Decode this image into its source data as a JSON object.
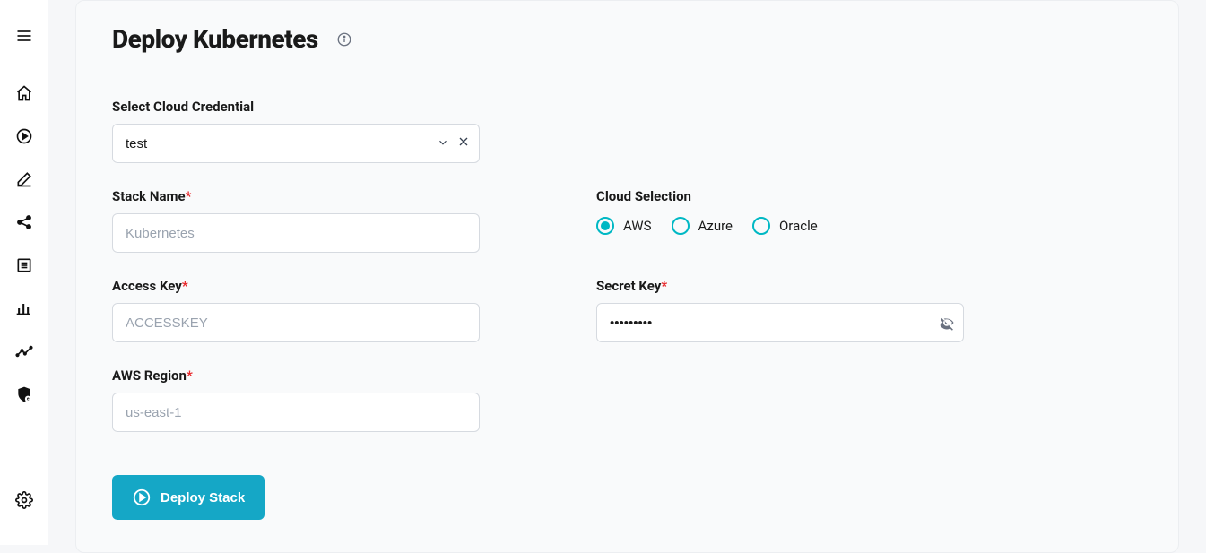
{
  "page": {
    "title": "Deploy Kubernetes"
  },
  "form": {
    "credential": {
      "label": "Select Cloud Credential",
      "value": "test"
    },
    "stackName": {
      "label": "Stack Name",
      "placeholder": "Kubernetes",
      "value": ""
    },
    "cloudSelection": {
      "label": "Cloud Selection",
      "options": [
        {
          "key": "aws",
          "label": "AWS",
          "checked": true
        },
        {
          "key": "azure",
          "label": "Azure",
          "checked": false
        },
        {
          "key": "oracle",
          "label": "Oracle",
          "checked": false
        }
      ]
    },
    "accessKey": {
      "label": "Access Key",
      "placeholder": "ACCESSKEY",
      "value": ""
    },
    "secretKey": {
      "label": "Secret Key",
      "value": "•••••••••"
    },
    "awsRegion": {
      "label": "AWS Region",
      "placeholder": "us-east-1",
      "value": ""
    },
    "deployButton": "Deploy Stack"
  },
  "sidebar": {
    "items": [
      "menu",
      "home",
      "play",
      "edit",
      "share",
      "list",
      "bar-chart",
      "trend",
      "shield"
    ],
    "bottom": "settings"
  }
}
